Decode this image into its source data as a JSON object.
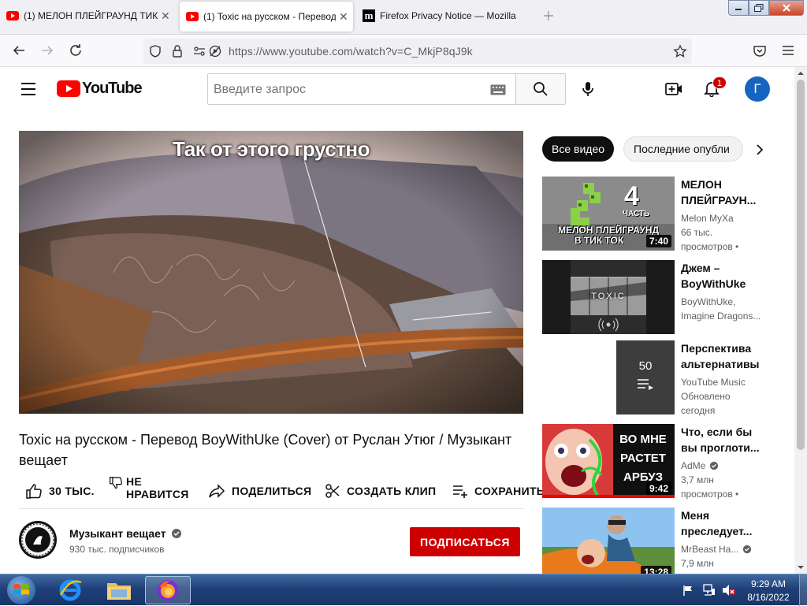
{
  "browser": {
    "tabs": [
      {
        "title": "(1) МЕЛОН ПЛЕЙГРАУНД ТИК",
        "close": "✕"
      },
      {
        "title": "(1) Toxic на русском - Перевод",
        "close": "✕"
      },
      {
        "title": "Firefox Privacy Notice — Mozilla"
      }
    ],
    "url": "https://www.youtube.com/watch?v=C_MkjP8qJ9k"
  },
  "youtube": {
    "logo_text": "YouTube",
    "search_placeholder": "Введите запрос",
    "notification_count": "1",
    "avatar_letter": "Г",
    "video": {
      "overlay_caption": "Так от этого грустно",
      "title": "Toxic на русском - Перевод BoyWithUke (Cover) от Руслан Утюг / Музыкант вещает",
      "likes": "30 ТЫС.",
      "dislike_label_1": "НЕ",
      "dislike_label_2": "НРАВИТСЯ",
      "share": "ПОДЕЛИТЬСЯ",
      "clip": "СОЗДАТЬ КЛИП",
      "save": "СОХРАНИТЬ"
    },
    "channel": {
      "name": "Музыкант вещает",
      "subscribers": "930 тыс. подписчиков",
      "subscribe_button": "ПОДПИСАТЬСЯ"
    },
    "chips": [
      "Все видео",
      "Последние опубли"
    ],
    "recommendations": [
      {
        "title": "МЕЛОН ПЛЕЙГРАУН...",
        "line1": "Melon MyXa",
        "line2": "66 тыс.",
        "line3": "просмотров •",
        "duration": "7:40",
        "thumb_big": "4",
        "thumb_small": "ЧАСТЬ",
        "thumb_caption_1": "МЕЛОН ПЛЕЙГРАУНД",
        "thumb_caption_2": "В ТИК ТОК"
      },
      {
        "title": "Джем – BoyWithUke",
        "line1": "BoyWithUke,",
        "line2": "Imagine Dragons...",
        "thumb_caption": "TOXIC"
      },
      {
        "title": "Перспектива альтернативы",
        "line1": "YouTube Music",
        "line2": "Обновлено",
        "line3": "сегодня",
        "playlist_count": "50"
      },
      {
        "title": "Что, если бы вы проглоти...",
        "line1": "AdMe",
        "line2": "3,7 млн",
        "line3": "просмотров •",
        "duration": "9:42",
        "thumb_text_1": "ВО МНЕ",
        "thumb_text_2": "РАСТЕТ",
        "thumb_text_3": "АРБУЗ"
      },
      {
        "title": "Меня преследует...",
        "line1": "MrBeast Ha...",
        "line2": "7,9 млн",
        "duration": "13:28"
      }
    ]
  },
  "taskbar": {
    "time": "9:29 AM",
    "date": "8/16/2022"
  }
}
